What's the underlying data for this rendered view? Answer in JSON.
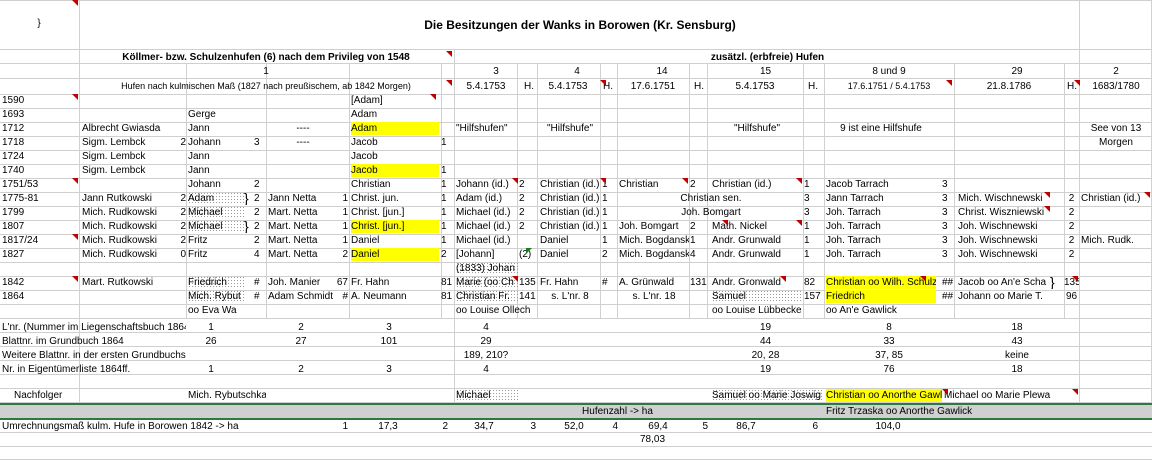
{
  "title": "Die Besitzungen der Wanks in Borowen (Kr. Sensburg)",
  "corner": "}",
  "h_koellmer": "Köllmer- bzw. Schulzenhufen (6) nach dem Privileg von 1548",
  "h_extra": "zusätzl. (erbfreie) Hufen",
  "hufen_nums": [
    "1",
    "3",
    "4",
    "14",
    "15",
    "8 und 9",
    "29",
    "2"
  ],
  "measure_note": "Hufen nach kulmischen Maß (1827 nach preußischem, ab 1842 Morgen)",
  "dates": [
    "5.4.1753",
    "5.4.1753",
    "17.6.1751",
    "5.4.1753",
    "17.6.1751 / 5.4.1753",
    "21.8.1786",
    "1683/1780"
  ],
  "h_unit": "H.",
  "years": [
    "1590",
    "1693",
    "1712",
    "1718",
    "1724",
    "1740",
    "1751/53",
    "1775-81",
    "1799",
    "1807",
    "1817/24",
    "1827",
    "1842",
    "1864"
  ],
  "c1": [
    "",
    "",
    "Albrecht Gwiasda",
    "Sigm. Lembck",
    "Sigm. Lembck",
    "Sigm. Lembck",
    "",
    "Jann Rutkowski",
    "Mich. Rudkowski",
    "Mich. Rudkowski",
    "Mich. Rudkowski",
    "Mich. Rudkowski",
    "Mart. Rutkowski",
    ""
  ],
  "c1n": [
    "",
    "",
    "",
    "2",
    "",
    "",
    "",
    "2",
    "2",
    "2",
    "2",
    "0",
    "",
    ""
  ],
  "c2": [
    "",
    "Gerge",
    "Jann",
    "Johann",
    "Jann",
    "Jann",
    "Johann",
    "Adam",
    "Michael",
    "Michael",
    "Fritz",
    "Fritz",
    "Friedrich",
    "Mich. Rybut"
  ],
  "c2n": [
    "",
    "",
    "",
    "3",
    "",
    "",
    "2",
    "2",
    "2",
    "2",
    "2",
    "4",
    "#",
    "#"
  ],
  "c3": [
    "",
    "",
    "----",
    "----",
    "",
    "",
    "",
    "Jann Netta",
    "Mart. Netta",
    "Mart. Netta",
    "Mart. Netta",
    "Mart. Netta",
    "Joh. Manier",
    "Adam Schmidt"
  ],
  "c3n": [
    "",
    "",
    "",
    "",
    "",
    "",
    "",
    "1",
    "1",
    "1",
    "1",
    "2",
    "67",
    "#"
  ],
  "c4": [
    "[Adam]",
    "Adam",
    "Adam",
    "Jacob",
    "Jacob",
    "Jacob",
    "Christian",
    "Christ. jun.",
    "Christ. [jun.]",
    "Christ. [jun.]",
    "Daniel",
    "Daniel",
    "Fr. Hahn",
    "A. Neumann"
  ],
  "c4n": [
    "",
    "",
    "",
    "1",
    "",
    "1",
    "1",
    "1",
    "1",
    "1",
    "1",
    "2",
    "81",
    "81"
  ],
  "r1864_extra": "oo Eva Wa",
  "c5": [
    "",
    "",
    "\"Hilfshufen\"",
    "",
    "",
    "",
    "Johann (id.)",
    "Adam (id.)",
    "Michael (id.)",
    "Michael (id.)",
    "Michael (id.)",
    "[Johann]",
    "Marie (oo Ch",
    "Christian Fr."
  ],
  "c5n": [
    "",
    "",
    "",
    "",
    "",
    "",
    "2",
    "2",
    "2",
    "2",
    "",
    "(2)",
    "135",
    "141"
  ],
  "c5pre": "(1833) Johan",
  "c5post": "oo Louise Ollech",
  "c6": [
    "",
    "",
    "\"Hilfshufe\"",
    "",
    "",
    "",
    "Christian (id.)",
    "Christian (id.)",
    "Christian (id.)",
    "Christian (id.)",
    "Daniel",
    "Daniel",
    "Fr. Hahn",
    "s. L'nr. 8"
  ],
  "c6n": [
    "",
    "",
    "",
    "",
    "",
    "",
    "1",
    "1",
    "1",
    "1",
    "1",
    "2",
    "#",
    ""
  ],
  "c7": [
    "",
    "",
    "",
    "",
    "",
    "",
    "Christian",
    "",
    "",
    "Joh. Bomgart",
    "Mich. Bogdanski",
    "Mich. Bogdanski",
    "A. Grünwald",
    "s. L'nr. 18"
  ],
  "c7n": [
    "",
    "",
    "",
    "",
    "",
    "",
    "2",
    "",
    "",
    "2",
    "1",
    "4",
    "131",
    ""
  ],
  "c7span": [
    "Christian sen.",
    "Joh. Bomgart"
  ],
  "c8": [
    "",
    "",
    "\"Hilfshufe\"",
    "",
    "",
    "",
    "Christian (id.)",
    "",
    "",
    "Math. Nickel",
    "Andr. Grunwald",
    "Andr. Grunwald",
    "Andr. Gronwald",
    "Samuel"
  ],
  "c8n": [
    "",
    "",
    "",
    "",
    "",
    "",
    "1",
    "3",
    "3",
    "1",
    "1",
    "1",
    "82",
    "157"
  ],
  "c8post": "oo Louise Lübbecke",
  "c9": [
    "",
    "",
    "9 ist eine Hilfshufe",
    "",
    "",
    "",
    "Jacob Tarrach",
    "Jann Tarrach",
    "Joh. Tarrach",
    "Joh. Tarrach",
    "Joh. Tarrach",
    "Joh. Tarrach",
    "Christian oo Wilh. Schulz",
    "Friedrich"
  ],
  "c9n": [
    "",
    "",
    "",
    "",
    "",
    "",
    "3",
    "3",
    "3",
    "3",
    "3",
    "3",
    "##",
    "##"
  ],
  "c9post": "oo An'e Gawlick",
  "c10": [
    "",
    "",
    "",
    "",
    "",
    "",
    "",
    "Mich. Wischnewski",
    "Christ. Wiszniewski",
    "Joh. Wischnewski",
    "Joh. Wischnewski",
    "Joh. Wischnewski",
    "Jacob oo An'e Scha",
    "Johann oo Marie T."
  ],
  "c10n": [
    "",
    "",
    "",
    "",
    "",
    "",
    "",
    "2",
    "2",
    "2",
    "2",
    "2",
    "135",
    "96"
  ],
  "c11": [
    "",
    "",
    "See von 13",
    "Morgen",
    "",
    "",
    "",
    "Christian (id.)",
    "",
    "",
    "Mich. Rudk.",
    "",
    "",
    ""
  ],
  "f_labels": [
    "L'nr. (Nummer im Liegenschaftsbuch 1864)",
    "Blattnr. im Grundbuch 1864",
    "Weitere Blattnr. in der ersten Grundbuchserie",
    "Nr. in Eigentümerliste 1864ff."
  ],
  "f_rows": [
    [
      "1",
      "2",
      "3",
      "4",
      "19",
      "8",
      "18"
    ],
    [
      "26",
      "27",
      "101",
      "29",
      "44",
      "33",
      "43"
    ],
    [
      "",
      "",
      "",
      "189, 210?",
      "20, 28",
      "37, 85",
      "keine"
    ],
    [
      "1",
      "2",
      "3",
      "4",
      "19",
      "76",
      "18"
    ]
  ],
  "nach_label": "Nachfolger",
  "nach": [
    "Mich. Rybutschka",
    "Michael",
    "Samuel oo Marie Joswig",
    "Christian oo Anorthe Gawlick",
    "Michael oo Marie Plewa"
  ],
  "bar_text": "Hufenzahl -> ha",
  "bar_right": "Fritz Trzaska oo Anorthe Gawlick",
  "conv_label": "Umrechnungsmaß kulm. Hufe in Borowen 1842 -> ha",
  "conv_vals": [
    "1",
    "17,3",
    "2",
    "34,7",
    "3",
    "52,0",
    "4",
    "69,4",
    "5",
    "86,7",
    "6",
    "104,0"
  ],
  "conv_sum": "78,03",
  "brace": "}"
}
